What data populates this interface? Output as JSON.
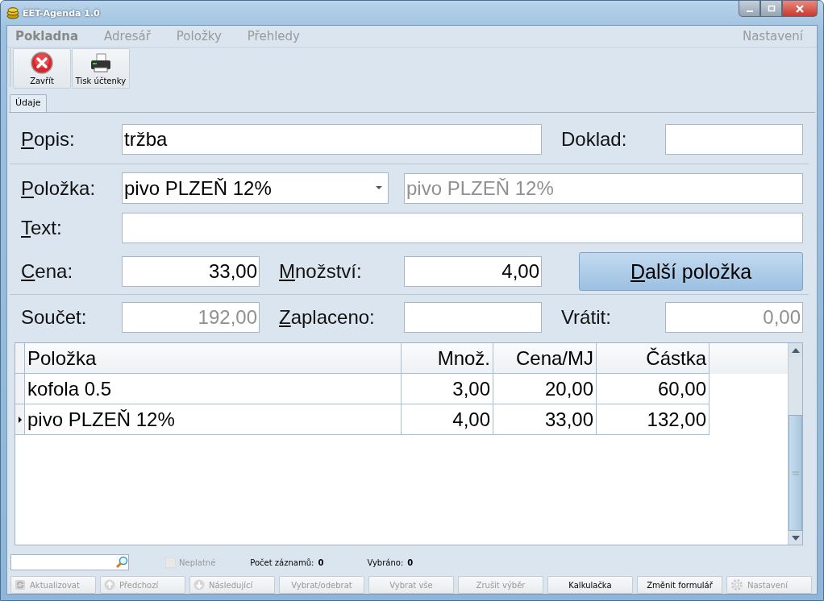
{
  "window": {
    "title": "EET-Agenda 1.0"
  },
  "menu": {
    "items": [
      {
        "label": "Pokladna",
        "selected": true
      },
      {
        "label": "Adresář",
        "selected": false
      },
      {
        "label": "Položky",
        "selected": false
      },
      {
        "label": "Přehledy",
        "selected": false
      }
    ],
    "right": "Nastavení"
  },
  "toolbar": [
    {
      "label": "Zavřít"
    },
    {
      "label": "Tisk účtenky"
    }
  ],
  "tabs": [
    {
      "label": "Údaje",
      "selected": true
    }
  ],
  "form": {
    "popis": {
      "key": "P",
      "rest": "opis:",
      "value": "tržba"
    },
    "doklad": {
      "label": "Doklad:"
    },
    "polozka": {
      "key": "P",
      "rest": "oložka:",
      "value": "pivo PLZEŇ 12%",
      "name_value": "pivo PLZEŇ 12%",
      "name_disabled": true
    },
    "text": {
      "key": "T",
      "rest": "ext:"
    },
    "cena": {
      "key": "C",
      "rest": "ena:",
      "value": "33,00"
    },
    "mnozstvi": {
      "key": "M",
      "rest": "nožství:",
      "value": "4,00"
    },
    "next_button": {
      "key": "D",
      "rest": "alší položka"
    },
    "soucet": {
      "label": "Součet:",
      "value": "192,00",
      "disabled": true
    },
    "zaplaceno": {
      "key": "Z",
      "rest": "aplaceno:"
    },
    "vratit": {
      "label": "Vrátit:",
      "value": "0,00",
      "disabled": true
    }
  },
  "table": {
    "columns": [
      "Položka",
      "Množ.",
      "Cena/MJ",
      "Částka"
    ],
    "rows": [
      {
        "cells": [
          "kofola 0.5",
          "3,00",
          "20,00",
          "60,00"
        ],
        "selected": false
      },
      {
        "cells": [
          "pivo PLZEŇ 12%",
          "4,00",
          "33,00",
          "132,00"
        ],
        "selected": true
      }
    ]
  },
  "status": {
    "invalid": {
      "label": "Neplatné",
      "disabled": true
    },
    "count_label": "Počet záznamů:",
    "count": "0",
    "selected_label": "Vybráno:",
    "selected_count": "0"
  },
  "buttons": [
    {
      "label": "Aktualizovat",
      "disabled": true
    },
    {
      "label": "Předchozí",
      "disabled": true
    },
    {
      "label": "Následující",
      "disabled": true
    },
    {
      "label": "Vybrat/odebrat",
      "disabled": true
    },
    {
      "label": "Vybrat vše",
      "disabled": true
    },
    {
      "label": "Zrušit výběr",
      "disabled": true
    },
    {
      "label": "Kalkulačka",
      "disabled": false
    },
    {
      "label": "Změnit formulář",
      "disabled": false
    },
    {
      "label": "Nastavení",
      "disabled": true
    }
  ]
}
